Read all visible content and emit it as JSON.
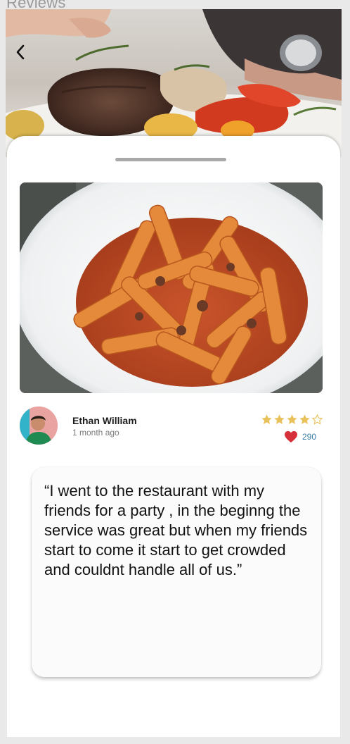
{
  "frame": {
    "title": "Reviews"
  },
  "hero": {
    "back_icon": "chevron-left-icon"
  },
  "reviewer": {
    "name": "Ethan William",
    "time": "1 month ago",
    "rating": 4,
    "max_rating": 5,
    "likes": "290"
  },
  "review": {
    "text": "“I went to the restaurant with my friends for a party , in the beginng the service was great but when my friends start to come it start to get crowded and couldnt handle all of us.”"
  },
  "colors": {
    "star": "#e8c15a",
    "heart": "#d6303b",
    "likes_text": "#3b7fa5"
  }
}
